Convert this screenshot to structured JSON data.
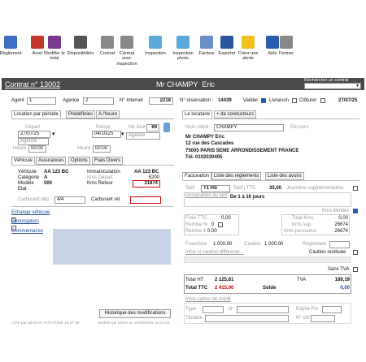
{
  "toolbar": [
    {
      "label": "Règlement",
      "icon": "payment-icon",
      "color": "#3a6fc4"
    },
    {
      "label": "Avoir",
      "icon": "euro-credit-icon",
      "color": "#c0392b"
    },
    {
      "label": "Modifier le total",
      "icon": "euro-edit-icon",
      "color": "#7a3b8f"
    },
    {
      "label": "Disponibilités",
      "icon": "car-availability-icon",
      "color": "#555"
    },
    {
      "label": "Contrat",
      "icon": "contract-icon",
      "color": "#888"
    },
    {
      "label": "Contrat avec inspection",
      "icon": "contract-inspection-icon",
      "color": "#888"
    },
    {
      "label": "Inspection",
      "icon": "inspection-icon",
      "color": "#5aa9d8"
    },
    {
      "label": "Inspection photo",
      "icon": "inspection-photo-icon",
      "color": "#5aa9d8"
    },
    {
      "label": "Facture",
      "icon": "invoice-icon",
      "color": "#6a8fc8"
    },
    {
      "label": "Exporter",
      "icon": "word-export-icon",
      "color": "#2b579a"
    },
    {
      "label": "Créer une alerte",
      "icon": "alert-icon",
      "color": "#f0c020"
    },
    {
      "label": "Aide",
      "icon": "help-icon",
      "color": "#2a5db0"
    },
    {
      "label": "Fermer",
      "icon": "close-icon",
      "color": "#888"
    }
  ],
  "header": {
    "contract": "Contrat n° 13002",
    "client": "Mr CHAMPY  Eric",
    "search_label": "Rechercher un contrat",
    "bg": "#4a4a4a"
  },
  "topline": {
    "agent_label": "Agent",
    "agent_value": "1",
    "agence_label": "Agence",
    "agence_value": "2",
    "internet_label": "N° Internet",
    "internet_value": "2218",
    "reservation_label": "N° réservation :",
    "reservation_value": "14439",
    "valider": "Valider",
    "livraison": "Livraison",
    "cloturer": "Clôturer",
    "date": "27/07/25"
  },
  "left": {
    "tabs": [
      "Location par période",
      "Prédéfinies",
      "A l'heure"
    ],
    "depart_label": "Départ",
    "depart_date": "27/07/25",
    "retour_label": "Retour",
    "retour_date": "04/10/25",
    "nbjour_label": "Nb Jour",
    "nbjour_value": "69",
    "agence1": "Agence",
    "agence2": "Agence",
    "heure_label1": "Heure",
    "heure1": "00:00",
    "heure_label2": "Heure",
    "heure2": "00:00",
    "vtabs": [
      "Véhicule",
      "Assurances",
      "Options",
      "Frais Divers"
    ],
    "vehicule_label": "Véhicule",
    "vehicule_value": "AA 123 BC",
    "categorie_label": "Catégorie",
    "categorie_value": "A",
    "modele_label": "Modèle",
    "modele_value": "500",
    "etat_label": "Etat",
    "immat_label": "Immatriculation",
    "immat_value": "AA 123 BC",
    "kmsdep_label": "Kms Départ",
    "kmsdep_value": "5200",
    "kmsret_label": "Kms Retour",
    "kmsret_value": "31874",
    "carbdep_label": "Carburant dép",
    "carbdep_value": "4/4",
    "carbret_label": "Carburant ret",
    "links": [
      "Echange véhicule",
      "Prolongation",
      "Commentaires"
    ],
    "historique": "Historique des modifications",
    "created": "Créé par admin le 27/07/2025 18:27:36",
    "modified": "Modifié par admin le 12/08/2025 11:54:33"
  },
  "right": {
    "tabs": [
      "Le locataire",
      "+ de conducteurs"
    ],
    "nomclient_label": "Nom client",
    "nomclient_value": "CHAMPY",
    "encours_label": "Encours:",
    "address": [
      "Mr CHAMPY Eric",
      "12 rue des Cascades",
      "75005 PARIS 5EME ARRONDISSEMENT FRANCE",
      "Tél. 0102030405"
    ],
    "ftabs": [
      "Facturation",
      "Liste des règlements",
      "Liste des avoirs"
    ],
    "tarif_label": "Tarif",
    "tarif_value": "T1 HS",
    "tarifttc_label": "Tarif j TTC",
    "tarifttc_value": "35,00",
    "jours_supp": "Journées supplémentaires",
    "designation_label": "Désignation du tarif",
    "designation_value": "De 1 à 16 jours",
    "kms_illimites": "Kms illimités",
    "frais_label": "Frais TTC",
    "frais_value": "0,00",
    "remise_pct_label": "Remise %",
    "remise_pct_value": "0",
    "remise_eur_label": "Remise €",
    "remise_eur_value": "0,00",
    "totalkms_label": "Total Kms",
    "totalkms_value": "0,00",
    "kmssup_label": "Kms sup",
    "kmssup_value": "26674",
    "kmsparc_label": "Kms parcourus",
    "kmsparc_value": "26674",
    "franchise_label": "Franchise",
    "franchise_value": "1 000,00",
    "caution_label": "Caution",
    "caution_value": "1 000,00",
    "reglement_label": "Règlement",
    "infos_caution": "Infos si caution différente...",
    "caution_restituee": "Caution restituée",
    "sans_tva": "Sans TVA",
    "totalht_label": "Total HT",
    "totalht_value": "2 225,81",
    "tva_label": "TVA",
    "tva_value": "189,19",
    "totalttc_label": "Total TTC",
    "totalttc_value": "2 415,00",
    "solde_label": "Solde",
    "solde_value": "0,00",
    "infos_cb": "Infos cartes de crédit",
    "type_label": "Type",
    "num_label": "N°",
    "expire_label": "Expire Fin",
    "titulaire_label": "Titulaire",
    "nctrl_label": "N° ctrl"
  }
}
